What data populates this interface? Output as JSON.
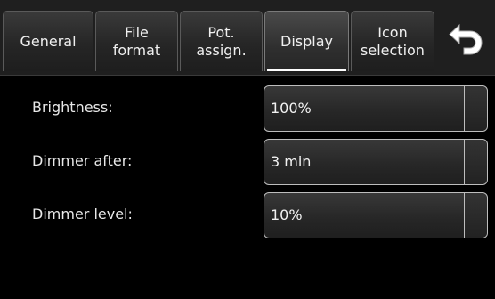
{
  "tabs": [
    {
      "label": "General",
      "active": false
    },
    {
      "label": "File\nformat",
      "active": false
    },
    {
      "label": "Pot.\nassign.",
      "active": false
    },
    {
      "label": "Display",
      "active": true
    },
    {
      "label": "Icon\nselection",
      "active": false
    }
  ],
  "back_icon": "undo-arrow-icon",
  "settings": [
    {
      "label": "Brightness:",
      "value": "100%"
    },
    {
      "label": "Dimmer after:",
      "value": "3 min"
    },
    {
      "label": "Dimmer level:",
      "value": "10%"
    }
  ],
  "colors": {
    "background": "#000000",
    "tab_background": "#2a2a2a",
    "text": "#e6e6e6",
    "active_underline": "#ffffff"
  }
}
